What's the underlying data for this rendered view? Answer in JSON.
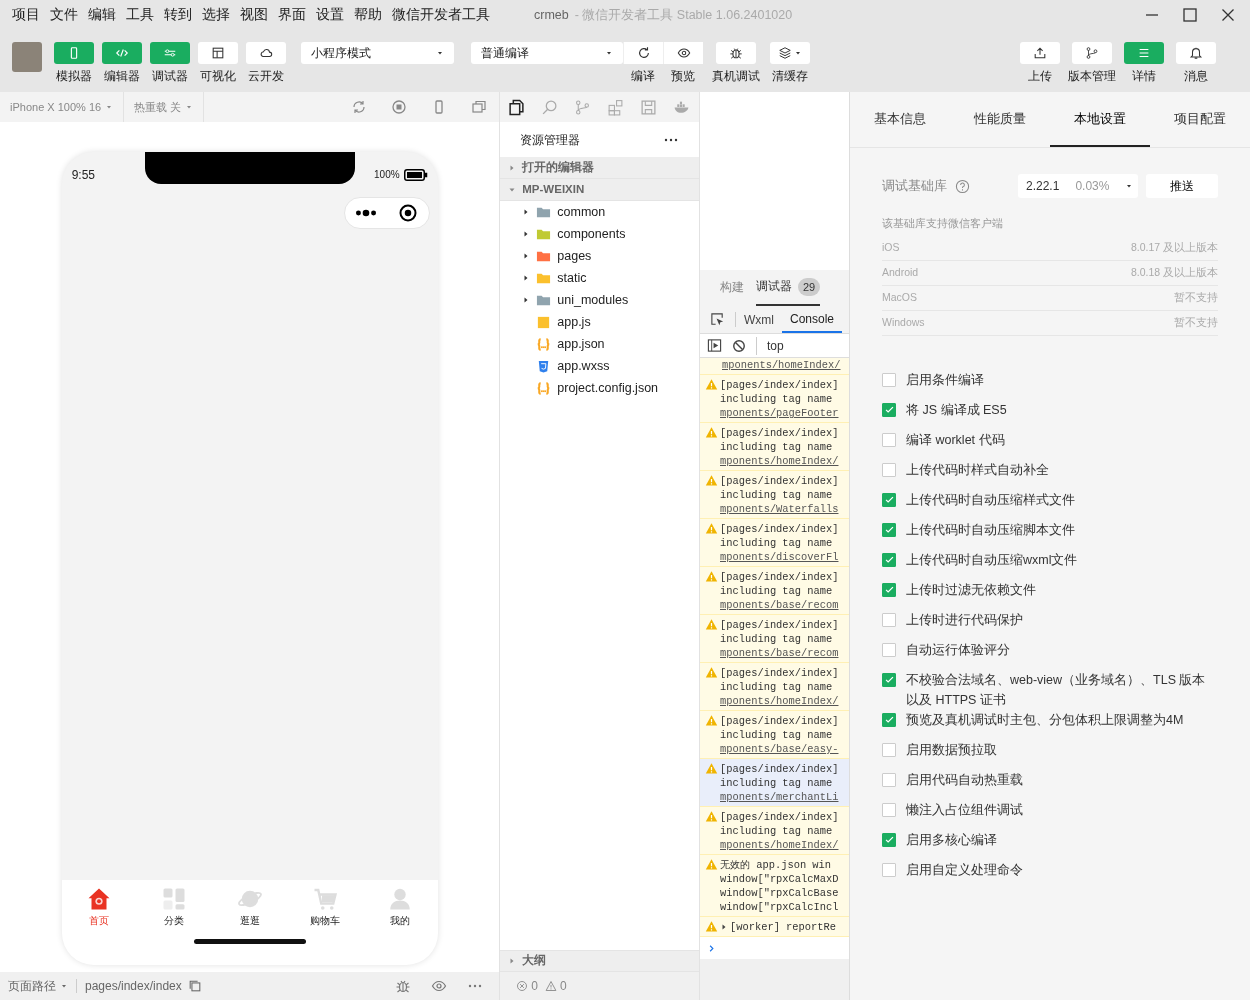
{
  "menu": [
    "项目",
    "文件",
    "编辑",
    "工具",
    "转到",
    "选择",
    "视图",
    "界面",
    "设置",
    "帮助",
    "微信开发者工具"
  ],
  "window_title": {
    "project": "crmeb",
    "app": "- 微信开发者工具 Stable 1.06.2401020"
  },
  "toolbar": {
    "view_buttons": [
      {
        "label": "模拟器",
        "active": true
      },
      {
        "label": "编辑器",
        "active": true
      },
      {
        "label": "调试器",
        "active": true
      },
      {
        "label": "可视化",
        "active": false
      },
      {
        "label": "云开发",
        "active": false
      }
    ],
    "mode_select": "小程序模式",
    "compile_select": "普通编译",
    "compile_buttons": [
      {
        "label": "编译"
      },
      {
        "label": "预览"
      }
    ],
    "action_buttons": [
      {
        "label": "真机调试"
      },
      {
        "label": "清缓存"
      }
    ],
    "right_buttons": [
      {
        "label": "上传",
        "active": false
      },
      {
        "label": "版本管理",
        "active": false
      },
      {
        "label": "详情",
        "active": true
      },
      {
        "label": "消息",
        "active": false
      }
    ]
  },
  "simulator": {
    "device": "iPhone X 100% 16",
    "hot_reload": "热重载 关",
    "time": "9:55",
    "battery": "100%",
    "tabbar": [
      {
        "label": "首页",
        "selected": true
      },
      {
        "label": "分类",
        "selected": false
      },
      {
        "label": "逛逛",
        "selected": false
      },
      {
        "label": "购物车",
        "selected": false
      },
      {
        "label": "我的",
        "selected": false
      }
    ],
    "path_label": "页面路径",
    "path": "pages/index/index"
  },
  "explorer": {
    "title": "资源管理器",
    "sections": [
      {
        "label": "打开的编辑器",
        "expanded": false
      },
      {
        "label": "MP-WEIXIN",
        "expanded": true
      }
    ],
    "files": [
      {
        "name": "common",
        "kind": "folder",
        "color": "#90a4ae"
      },
      {
        "name": "components",
        "kind": "folder",
        "color": "#c0ca33"
      },
      {
        "name": "pages",
        "kind": "folder",
        "color": "#ff7043"
      },
      {
        "name": "static",
        "kind": "folder",
        "color": "#fbc02d"
      },
      {
        "name": "uni_modules",
        "kind": "folder",
        "color": "#90a4ae"
      },
      {
        "name": "app.js",
        "kind": "js",
        "color": "#fbc02d"
      },
      {
        "name": "app.json",
        "kind": "json",
        "color": "#f9a825"
      },
      {
        "name": "app.wxss",
        "kind": "css",
        "color": "#2f80ed"
      },
      {
        "name": "project.config.json",
        "kind": "json",
        "color": "#f9a825"
      }
    ],
    "outline": "大纲",
    "errors": "0",
    "warnings": "0"
  },
  "debugger": {
    "tabs": [
      {
        "label": "构建",
        "selected": false
      },
      {
        "label": "调试器",
        "selected": true,
        "count": "29"
      }
    ],
    "subtabs": [
      {
        "label": "Wxml",
        "selected": false
      },
      {
        "label": "Console",
        "selected": true
      }
    ],
    "context": "top",
    "logs": [
      {
        "kind": "continuation",
        "link": "mponents/homeIndex/",
        "selected": false
      },
      {
        "kind": "warning",
        "lines": [
          "[pages/index/index]",
          "including tag name"
        ],
        "link": "mponents/pageFooter",
        "selected": false
      },
      {
        "kind": "warning",
        "lines": [
          "[pages/index/index]",
          "including tag name"
        ],
        "link": "mponents/homeIndex/",
        "selected": false
      },
      {
        "kind": "warning",
        "lines": [
          "[pages/index/index]",
          "including tag name"
        ],
        "link": "mponents/Waterfalls",
        "selected": false
      },
      {
        "kind": "warning",
        "lines": [
          "[pages/index/index]",
          "including tag name"
        ],
        "link": "mponents/discoverFl",
        "selected": false
      },
      {
        "kind": "warning",
        "lines": [
          "[pages/index/index]",
          "including tag name"
        ],
        "link": "mponents/base/recom",
        "selected": false
      },
      {
        "kind": "warning",
        "lines": [
          "[pages/index/index]",
          "including tag name"
        ],
        "link": "mponents/base/recom",
        "selected": false
      },
      {
        "kind": "warning",
        "lines": [
          "[pages/index/index]",
          "including tag name"
        ],
        "link": "mponents/homeIndex/",
        "selected": false
      },
      {
        "kind": "warning",
        "lines": [
          "[pages/index/index]",
          "including tag name"
        ],
        "link": "mponents/base/easy-",
        "selected": false
      },
      {
        "kind": "warning",
        "lines": [
          "[pages/index/index]",
          "including tag name"
        ],
        "link": "mponents/merchantLi",
        "selected": true
      },
      {
        "kind": "warning",
        "lines": [
          "[pages/index/index]",
          "including tag name"
        ],
        "link": "mponents/homeIndex/",
        "selected": false
      },
      {
        "kind": "warning",
        "lines": [
          "无效的 app.json win",
          "window[\"rpxCalcMaxD",
          "window[\"rpxCalcBase",
          "window[\"rpxCalcIncl"
        ],
        "selected": false
      },
      {
        "kind": "collapsed",
        "lines": [
          "[worker] reportRe"
        ],
        "selected": false
      }
    ]
  },
  "details": {
    "tabs": [
      {
        "label": "基本信息",
        "selected": false
      },
      {
        "label": "性能质量",
        "selected": false
      },
      {
        "label": "本地设置",
        "selected": true
      },
      {
        "label": "项目配置",
        "selected": false
      }
    ],
    "lib_label": "调试基础库",
    "lib_version": "2.22.1",
    "lib_share": "0.03%",
    "push": "推送",
    "support_title": "该基础库支持微信客户端",
    "support": [
      {
        "platform": "iOS",
        "value": "8.0.17 及以上版本"
      },
      {
        "platform": "Android",
        "value": "8.0.18 及以上版本"
      },
      {
        "platform": "MacOS",
        "value": "暂不支持"
      },
      {
        "platform": "Windows",
        "value": "暂不支持"
      }
    ],
    "options": [
      {
        "label": "启用条件编译",
        "checked": false
      },
      {
        "label": "将 JS 编译成 ES5",
        "checked": true
      },
      {
        "label": "编译 worklet 代码",
        "checked": false
      },
      {
        "label": "上传代码时样式自动补全",
        "checked": false
      },
      {
        "label": "上传代码时自动压缩样式文件",
        "checked": true
      },
      {
        "label": "上传代码时自动压缩脚本文件",
        "checked": true
      },
      {
        "label": "上传代码时自动压缩wxml文件",
        "checked": true
      },
      {
        "label": "上传时过滤无依赖文件",
        "checked": true
      },
      {
        "label": "上传时进行代码保护",
        "checked": false
      },
      {
        "label": "自动运行体验评分",
        "checked": false
      },
      {
        "label": "不校验合法域名、web-view（业务域名）、TLS 版本以及 HTTPS 证书",
        "checked": true
      },
      {
        "label": "预览及真机调试时主包、分包体积上限调整为4M",
        "checked": true
      },
      {
        "label": "启用数据预拉取",
        "checked": false
      },
      {
        "label": "启用代码自动热重载",
        "checked": false
      },
      {
        "label": "懒注入占位组件调试",
        "checked": false
      },
      {
        "label": "启用多核心编译",
        "checked": true
      },
      {
        "label": "启用自定义处理命令",
        "checked": false
      }
    ]
  }
}
